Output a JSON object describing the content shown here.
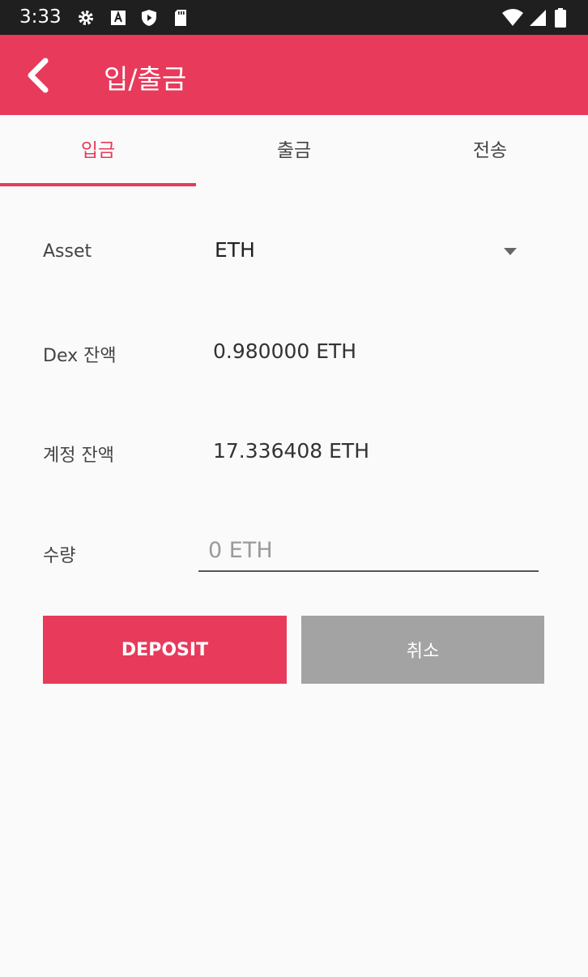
{
  "status_bar": {
    "time": "3:33",
    "icons": [
      "gear-icon",
      "a-box-icon",
      "shield-play-icon",
      "sd-card-icon",
      "wifi-icon",
      "signal-icon",
      "battery-icon"
    ]
  },
  "app_bar": {
    "title": "입/출금",
    "back_icon": "chevron-left-icon"
  },
  "tabs": [
    {
      "label": "입금",
      "active": true
    },
    {
      "label": "출금",
      "active": false
    },
    {
      "label": "전송",
      "active": false
    }
  ],
  "form": {
    "asset_label": "Asset",
    "asset_value": "ETH",
    "dex_balance_label": "Dex 잔액",
    "dex_balance_value": "0.980000 ETH",
    "account_balance_label": "계정 잔액",
    "account_balance_value": "17.336408 ETH",
    "amount_label": "수량",
    "amount_placeholder": "0 ETH",
    "amount_value": ""
  },
  "buttons": {
    "deposit_label": "DEPOSIT",
    "cancel_label": "취소"
  },
  "colors": {
    "accent": "#e83a5b",
    "status_bar": "#1f1f1f",
    "cancel_button": "#a3a3a3",
    "background": "#fafafa"
  }
}
